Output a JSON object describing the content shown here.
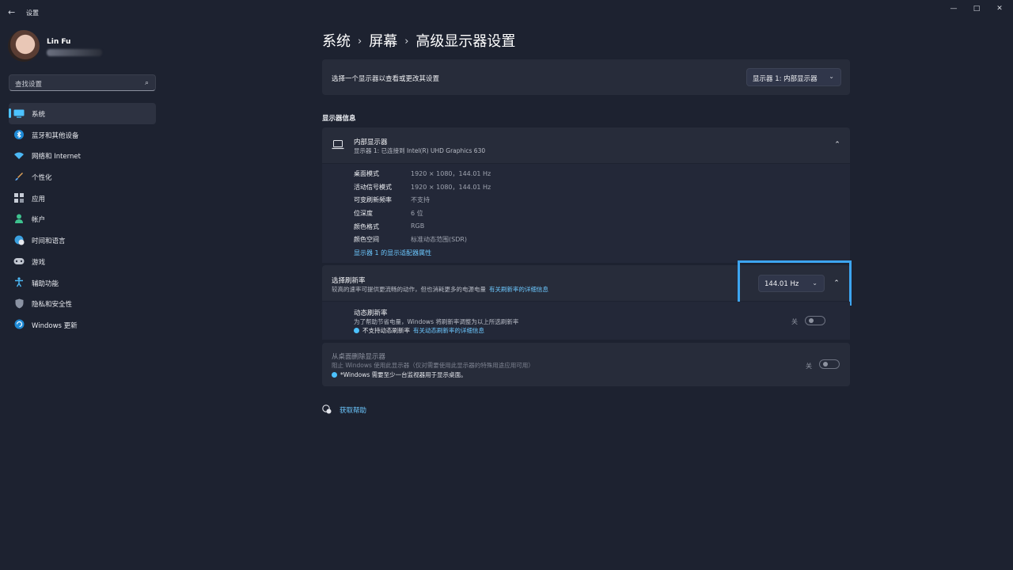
{
  "window": {
    "title": "设置",
    "back_icon": "←",
    "minimize_icon": "—",
    "maximize_icon": "□",
    "close_icon": "✕"
  },
  "profile": {
    "name": "Lin Fu"
  },
  "search": {
    "placeholder": "查找设置",
    "icon": "⌕"
  },
  "sidebar": {
    "items": [
      {
        "label": "系统",
        "icon": "display-icon",
        "active": true
      },
      {
        "label": "蓝牙和其他设备",
        "icon": "bluetooth-icon"
      },
      {
        "label": "网络和 Internet",
        "icon": "wifi-icon"
      },
      {
        "label": "个性化",
        "icon": "brush-icon"
      },
      {
        "label": "应用",
        "icon": "apps-icon"
      },
      {
        "label": "帐户",
        "icon": "person-icon"
      },
      {
        "label": "时间和语言",
        "icon": "globe-clock-icon"
      },
      {
        "label": "游戏",
        "icon": "gamepad-icon"
      },
      {
        "label": "辅助功能",
        "icon": "accessibility-icon"
      },
      {
        "label": "隐私和安全性",
        "icon": "shield-icon"
      },
      {
        "label": "Windows 更新",
        "icon": "update-icon"
      }
    ]
  },
  "breadcrumb": {
    "level1": "系统",
    "level2": "屏幕",
    "level3": "高级显示器设置",
    "sep": "›"
  },
  "display_selector": {
    "label": "选择一个显示器以查看或更改其设置",
    "value": "显示器 1: 内部显示器",
    "chevron": "⌄"
  },
  "display_info": {
    "section_title": "显示器信息",
    "title": "内部显示器",
    "subtitle": "显示器 1: 已连接到 Intel(R) UHD Graphics 630",
    "collapse_icon": "⌃",
    "rows": [
      {
        "key": "桌面模式",
        "value": "1920 × 1080，144.01 Hz"
      },
      {
        "key": "活动信号模式",
        "value": "1920 × 1080，144.01 Hz"
      },
      {
        "key": "可变刷新频率",
        "value": "不支持"
      },
      {
        "key": "位深度",
        "value": "6 位"
      },
      {
        "key": "颜色格式",
        "value": "RGB"
      },
      {
        "key": "颜色空间",
        "value": "标准动态范围(SDR)"
      }
    ],
    "adapter_link": "显示器 1 的显示适配器属性"
  },
  "refresh_rate": {
    "title": "选择刷新率",
    "subtitle": "较高的速率可提供更流畅的动作，但也消耗更多的电源电量",
    "link": "有关刷新率的详细信息",
    "value": "144.01 Hz",
    "chevron": "⌄",
    "collapse_icon": "⌃"
  },
  "dynamic_refresh": {
    "title": "动态刷新率",
    "subtitle": "为了帮助节省电量，Windows 将刷新率调整为以上所选刷新率",
    "note": "不支持动态刷新率",
    "note_link": "有关动态刷新率的详细信息",
    "toggle_label": "关",
    "enabled": false
  },
  "remove_display": {
    "title": "从桌面删除显示器",
    "subtitle": "阻止 Windows 使用此显示器（仅对需要使用此显示器的特殊用途应用可用）",
    "note": "*Windows 需要至少一台监视器用于显示桌面。",
    "toggle_label": "关",
    "enabled": false
  },
  "help": {
    "label": "获取帮助"
  },
  "colors": {
    "accent": "#4cc2ff",
    "highlight_border": "#3da5f0",
    "background": "#1d2230",
    "card": "#272c3a"
  }
}
